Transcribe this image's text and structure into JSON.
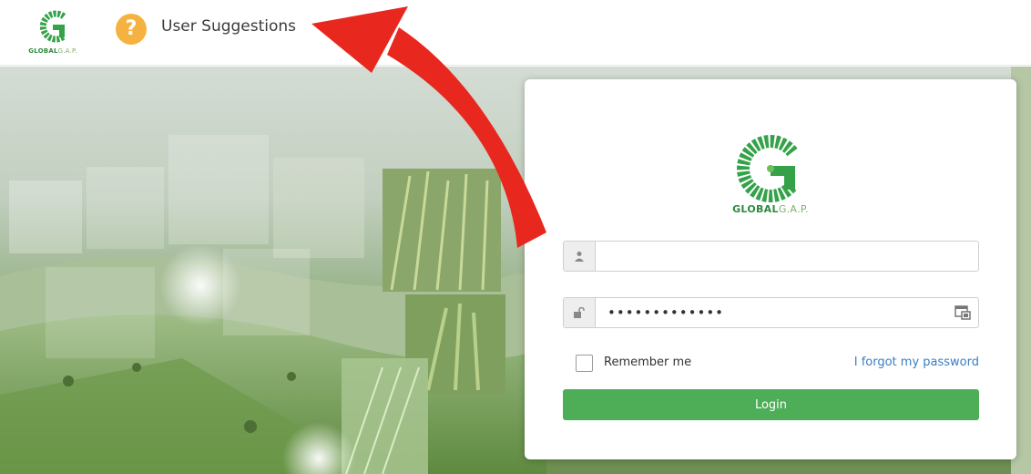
{
  "header": {
    "brand_bold": "GLOBAL",
    "brand_light": "G.A.P.",
    "help_icon_glyph": "?",
    "suggestions_label": "User Suggestions"
  },
  "login": {
    "brand_bold": "GLOBAL",
    "brand_light": "G.A.P.",
    "username_value": "",
    "password_value": "•••••••••••••",
    "remember_label": "Remember me",
    "forgot_label": "I forgot my password",
    "login_label": "Login"
  },
  "icons": {
    "help": "question-circle-icon",
    "user": "user-icon",
    "lock": "unlock-icon",
    "reveal": "password-reveal-icon",
    "arrow": "red-curved-arrow"
  },
  "colors": {
    "accent_green": "#4dae57",
    "brand_green": "#2d8a3e",
    "help_orange": "#f5b240",
    "link_blue": "#3a7dc4",
    "arrow_red": "#e8281e"
  }
}
